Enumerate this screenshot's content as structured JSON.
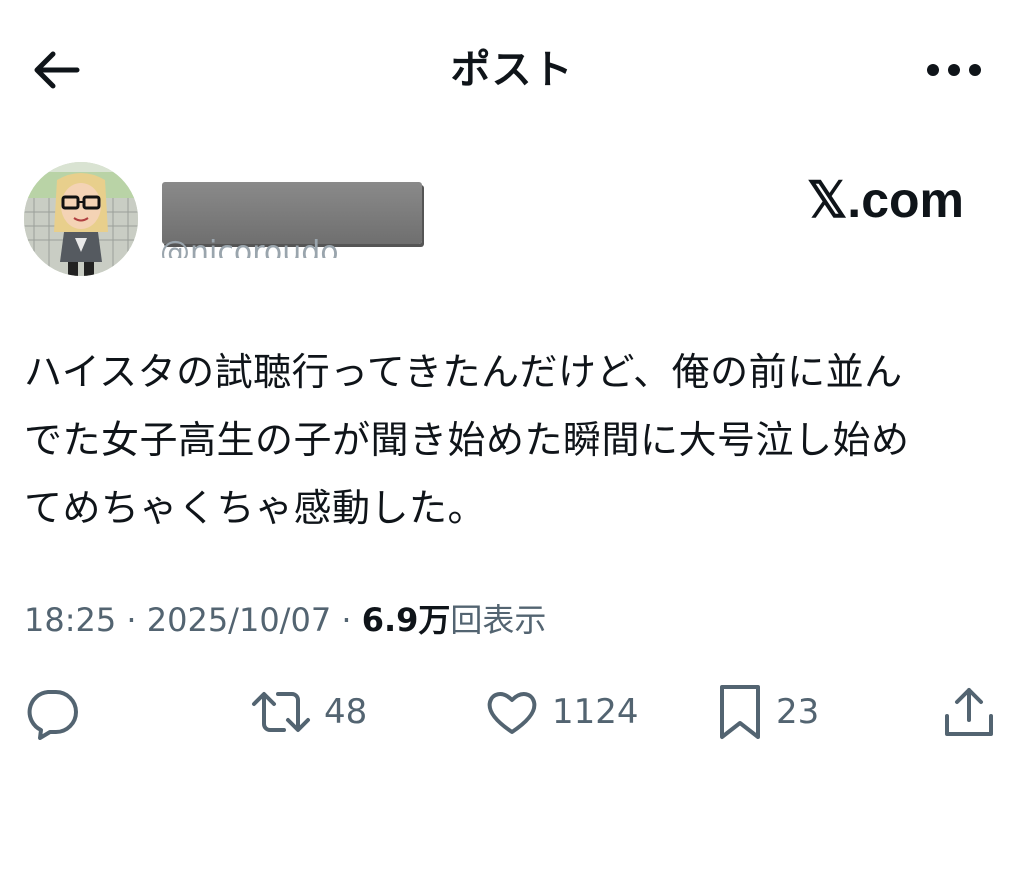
{
  "header": {
    "title": "ポスト",
    "back_icon": "arrow-left-icon",
    "more_icon": "more-horizontal-icon"
  },
  "author": {
    "handle": "@nicoroudo",
    "avatar_icon": "avatar-mii-character"
  },
  "brand": "𝕏.com",
  "post": {
    "lines": [
      "ハイスタの試聴行ってきたんだけど、俺の前に並ん",
      "でた女子高生の子が聞き始めた瞬間に大号泣し始め",
      "てめちゃくちゃ感動した。"
    ]
  },
  "meta": {
    "time": "18:25",
    "sep1": " · ",
    "date": "2025/10/07",
    "sep2": " · ",
    "views_count": "6.9万",
    "views_label": "回表示"
  },
  "actions": {
    "reply": {
      "icon": "reply-icon",
      "count": ""
    },
    "repost": {
      "icon": "repost-icon",
      "count": "48"
    },
    "like": {
      "icon": "heart-icon",
      "count": "1124"
    },
    "bookmark": {
      "icon": "bookmark-icon",
      "count": "23"
    },
    "share": {
      "icon": "share-icon",
      "count": ""
    }
  },
  "colors": {
    "text": "#0f1419",
    "secondary": "#536471",
    "background": "#ffffff"
  }
}
